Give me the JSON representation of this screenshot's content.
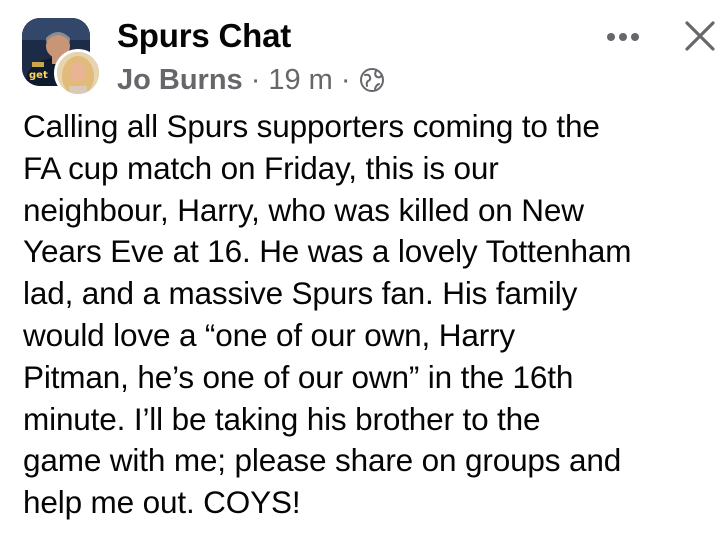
{
  "post": {
    "group_name": "Spurs Chat",
    "author": "Jo Burns",
    "separator": "·",
    "time": "19 m",
    "audience_icon": "globe-icon",
    "more_icon": "more-horizontal-icon",
    "close_icon": "close-icon",
    "group_avatar_badge": "get",
    "text": "Calling all Spurs supporters coming to the\nFA cup match on Friday, this is our\nneighbour, Harry, who was killed on New\nYears Eve at 16. He was a lovely Tottenham\nlad, and a massive Spurs fan. His family\nwould love a “one of our own, Harry\nPitman, he’s one of our own” in the 16th\nminute. I’ll be taking his brother to the\ngame with me; please share on groups and\nhelp me out. COYS!"
  },
  "colors": {
    "text": "#050505",
    "secondary_text": "#65676b",
    "background": "#ffffff",
    "group_avatar_bg": "#1b2a44"
  }
}
